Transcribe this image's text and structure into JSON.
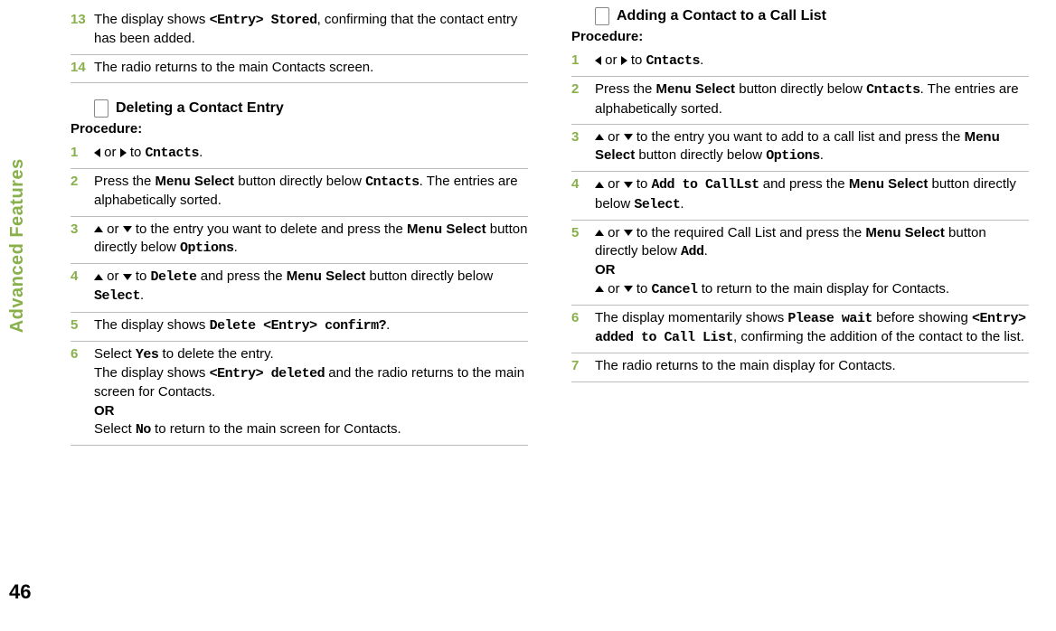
{
  "side_label": "Advanced Features",
  "page_number": "46",
  "left": {
    "step13": {
      "num": "13",
      "pre": "The display shows ",
      "mono": "<Entry> Stored",
      "post": ", confirming that the contact entry has been added."
    },
    "step14": {
      "num": "14",
      "text": "The radio returns to the main Contacts screen."
    },
    "section_title": "Deleting a Contact Entry",
    "procedure_label": "Procedure:",
    "d1": {
      "num": "1",
      "or": " or ",
      "to": " to ",
      "mono": "Cntacts",
      "post": "."
    },
    "d2": {
      "num": "2",
      "pre": "Press the ",
      "b1": "Menu Select",
      "mid": " button directly below ",
      "mono": "Cntacts",
      "post": ". The entries are alphabetically sorted."
    },
    "d3": {
      "num": "3",
      "or": " or ",
      "mid": " to the entry you want to delete and press the ",
      "b1": "Menu Select",
      "mid2": " button directly below ",
      "mono": "Options",
      "post": "."
    },
    "d4": {
      "num": "4",
      "or": " or ",
      "to": " to ",
      "mono1": "Delete",
      "mid": " and press the ",
      "b1": "Menu Select",
      "mid2": " button directly below ",
      "mono2": "Select",
      "post": "."
    },
    "d5": {
      "num": "5",
      "pre": "The display shows ",
      "mono": "Delete <Entry> confirm?",
      "post": "."
    },
    "d6": {
      "num": "6",
      "pre": "Select ",
      "mono1": "Yes",
      "mid": " to delete the entry.",
      "line2a": "The display shows ",
      "mono2": "<Entry> deleted",
      "line2b": " and the radio returns to the main screen for Contacts.",
      "or_label": "OR",
      "line3a": "Select ",
      "mono3": "No",
      "line3b": " to return to the main screen for Contacts."
    }
  },
  "right": {
    "section_title": "Adding a Contact to a Call List",
    "procedure_label": "Procedure:",
    "a1": {
      "num": "1",
      "or": " or ",
      "to": " to ",
      "mono": "Cntacts",
      "post": "."
    },
    "a2": {
      "num": "2",
      "pre": "Press the ",
      "b1": "Menu Select",
      "mid": " button directly below ",
      "mono": "Cntacts",
      "post": ". The entries are alphabetically sorted."
    },
    "a3": {
      "num": "3",
      "or": " or ",
      "mid": " to the entry you want to add to a call list and press the ",
      "b1": "Menu Select",
      "mid2": " button directly below ",
      "mono": "Options",
      "post": "."
    },
    "a4": {
      "num": "4",
      "or": " or ",
      "to": " to ",
      "mono1": "Add to CallLst",
      "mid": " and press the ",
      "b1": "Menu Select",
      "mid2": " button directly below ",
      "mono2": "Select",
      "post": "."
    },
    "a5": {
      "num": "5",
      "or": " or ",
      "mid": " to the required Call List and press the ",
      "b1": "Menu Select",
      "mid2": " button directly below ",
      "mono1": "Add",
      "post": ".",
      "or_label": "OR",
      "or2": " or ",
      "to2": " to ",
      "mono2": "Cancel",
      "tail": " to return to the main display for Contacts."
    },
    "a6": {
      "num": "6",
      "pre": "The display momentarily shows ",
      "mono1": "Please wait",
      "mid": " before showing ",
      "mono2": "<Entry> added to Call List",
      "post": ", confirming the addition of the contact to the list."
    },
    "a7": {
      "num": "7",
      "text": "The radio returns to the main display for Contacts."
    }
  }
}
